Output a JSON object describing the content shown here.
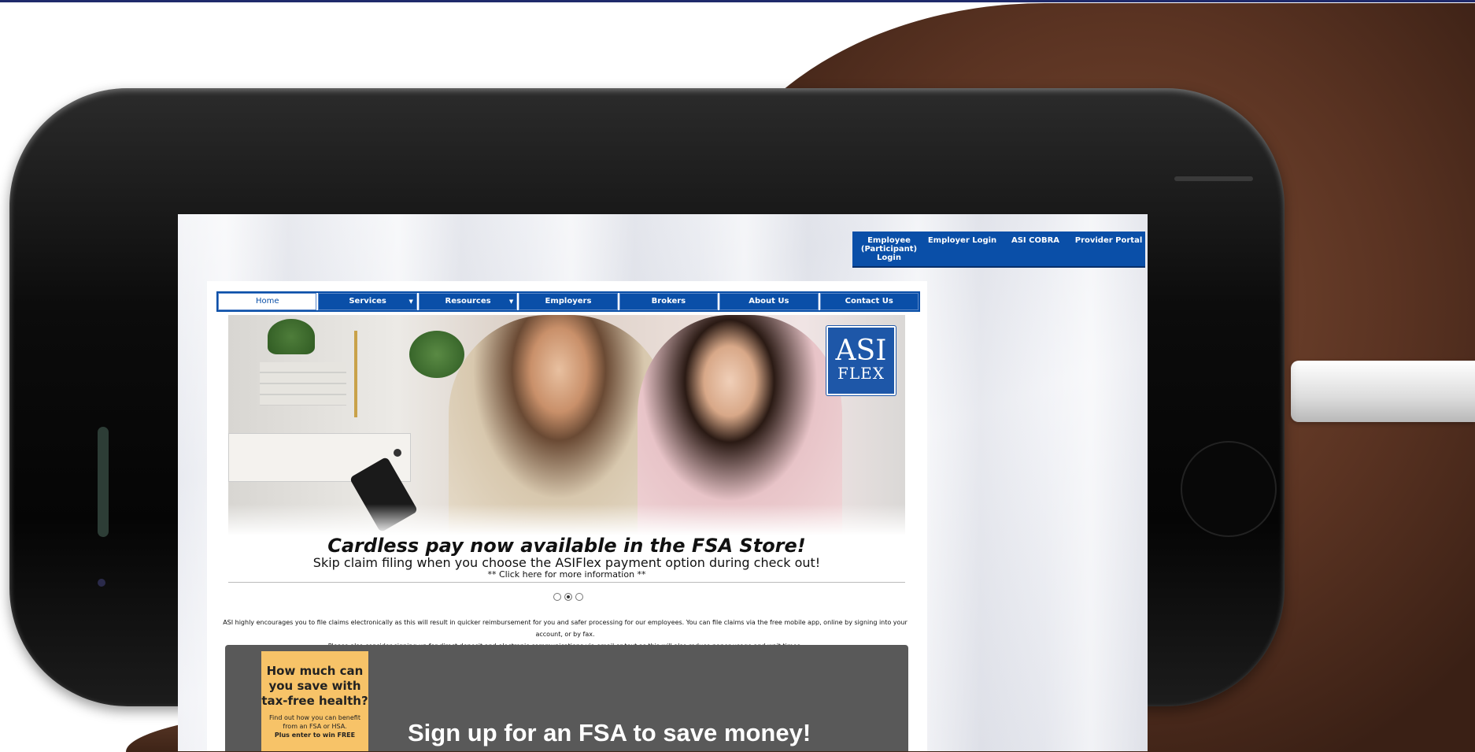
{
  "top_nav": [
    {
      "label": "Employee (Participant) Login"
    },
    {
      "label": "Employer Login"
    },
    {
      "label": "ASI COBRA"
    },
    {
      "label": "Provider Portal"
    }
  ],
  "main_nav": [
    {
      "label": "Home",
      "active": true
    },
    {
      "label": "Services",
      "dropdown": true
    },
    {
      "label": "Resources",
      "dropdown": true
    },
    {
      "label": "Employers"
    },
    {
      "label": "Brokers"
    },
    {
      "label": "About Us"
    },
    {
      "label": "Contact Us"
    }
  ],
  "logo": {
    "line1": "ASI",
    "line2": "FLEX"
  },
  "banner": {
    "title": "Cardless pay now available in the FSA Store!",
    "subtitle": "Skip claim filing when you choose the ASIFlex payment option during check out!",
    "link": "** Click here for more information **"
  },
  "carousel": {
    "count": 3,
    "active_index": 1
  },
  "notice": {
    "line1": "ASI highly encourages you to file claims electronically as this will result in quicker reimbursement for you and safer processing for our employees. You can file claims via the free mobile app, online by signing into your account, or by fax.",
    "line2": "Please also consider signing up for direct deposit and electronic communications via email or text as this will also reduce paper usage and wait times."
  },
  "promo": {
    "card_title": "How much can you save with tax-free health?",
    "card_text": "Find out how you can benefit from an FSA or HSA.",
    "card_bold": "Plus enter to win FREE",
    "headline": "Sign up for an FSA to save money!"
  },
  "colors": {
    "brand_blue": "#0a4fa8",
    "promo_bg": "#595959",
    "promo_card": "#f7c368"
  }
}
